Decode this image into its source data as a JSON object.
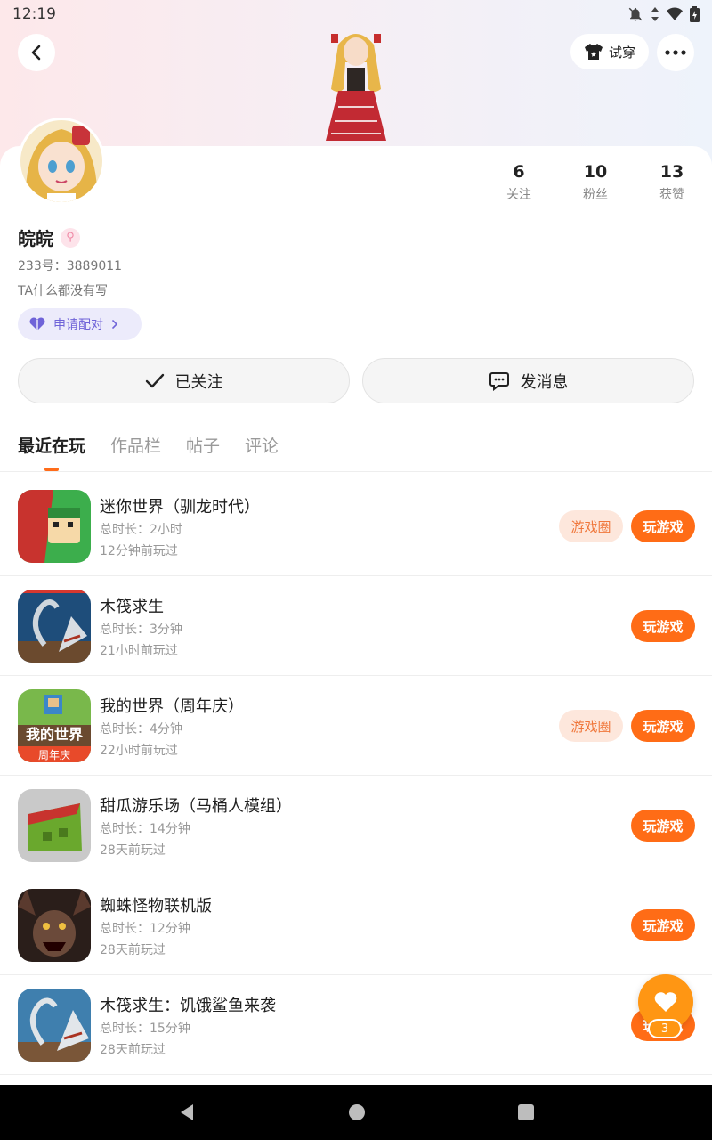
{
  "status_bar": {
    "time": "12:19"
  },
  "header": {
    "tryon_label": "试穿"
  },
  "stats": [
    {
      "num": "6",
      "label": "关注"
    },
    {
      "num": "10",
      "label": "粉丝"
    },
    {
      "num": "13",
      "label": "获赞"
    }
  ],
  "profile": {
    "nickname": "皖皖",
    "gender_icon": "female-icon",
    "uid": "233号：3889011",
    "bio": "TA什么都没有写",
    "match_label": "申请配对"
  },
  "actions": {
    "following_label": "已关注",
    "message_label": "发消息"
  },
  "tabs": [
    "最近在玩",
    "作品栏",
    "帖子",
    "评论"
  ],
  "games": [
    {
      "name": "迷你世界（驯龙时代）",
      "duration": "总时长：2小时",
      "last_played": "12分钟前玩过",
      "circle_label": "游戏圈",
      "play_label": "玩游戏"
    },
    {
      "name": "木筏求生",
      "duration": "总时长：3分钟",
      "last_played": "21小时前玩过",
      "play_label": "玩游戏"
    },
    {
      "name": "我的世界（周年庆）",
      "duration": "总时长：4分钟",
      "last_played": "22小时前玩过",
      "circle_label": "游戏圈",
      "play_label": "玩游戏"
    },
    {
      "name": "甜瓜游乐场（马桶人模组）",
      "duration": "总时长：14分钟",
      "last_played": "28天前玩过",
      "play_label": "玩游戏"
    },
    {
      "name": "蜘蛛怪物联机版",
      "duration": "总时长：12分钟",
      "last_played": "28天前玩过",
      "play_label": "玩游戏"
    },
    {
      "name": "木筏求生：饥饿鲨鱼来袭",
      "duration": "总时长：15分钟",
      "last_played": "28天前玩过",
      "play_label": "玩游戏"
    }
  ],
  "game_icon_text": {
    "mc_title": "我的世界",
    "mc_badge": "周年庆"
  },
  "fab": {
    "count": "3"
  },
  "colors": {
    "accent": "#ff6c16",
    "fab": "#ff9613",
    "match": "#6f63d8"
  }
}
